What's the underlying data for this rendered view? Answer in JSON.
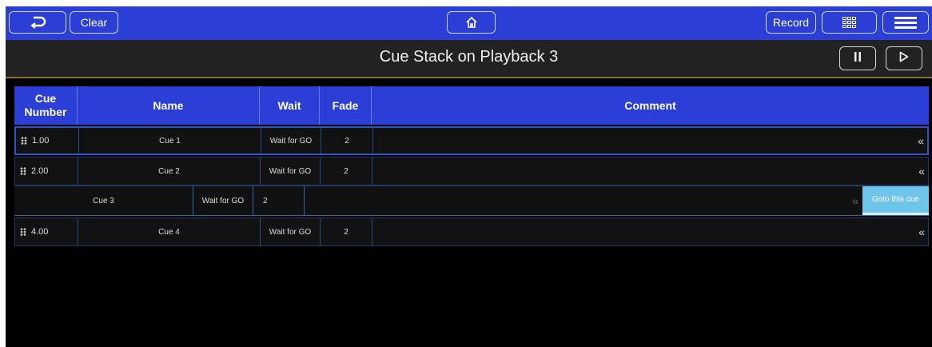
{
  "toolbar": {
    "back_icon": "undo-arrow-icon",
    "clear_label": "Clear",
    "home_icon": "home-icon",
    "record_label": "Record",
    "grid_icon": "grid-view-icon",
    "menu_icon": "hamburger-menu-icon"
  },
  "header": {
    "title": "Cue Stack on Playback 3",
    "pause_icon": "pause-icon",
    "play_icon": "play-icon"
  },
  "table": {
    "columns": [
      "Cue\nNumber",
      "Name",
      "Wait",
      "Fade",
      "Comment"
    ],
    "rows": [
      {
        "number": "1.00",
        "name": "Cue 1",
        "wait": "Wait for GO",
        "fade": "2",
        "comment": "",
        "chevron": "«"
      },
      {
        "number": "2.00",
        "name": "Cue 2",
        "wait": "Wait for GO",
        "fade": "2",
        "comment": "",
        "chevron": "«"
      },
      {
        "number": "4.00",
        "name": "Cue 4",
        "wait": "Wait for GO",
        "fade": "2",
        "comment": "",
        "chevron": "«"
      }
    ],
    "dragged_row": {
      "name": "Cue 3",
      "wait": "Wait for GO",
      "fade": "2",
      "chevron": "«",
      "action_label": "Goto this cue"
    }
  },
  "colors": {
    "accent": "#2b3fd6",
    "action": "#6fc4ea",
    "background": "#000000"
  }
}
